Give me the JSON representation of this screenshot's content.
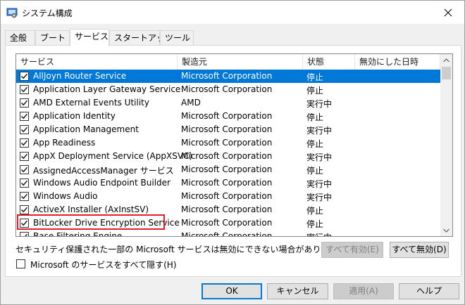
{
  "window": {
    "title": "システム構成"
  },
  "tabs": [
    {
      "label": "全般"
    },
    {
      "label": "ブート"
    },
    {
      "label": "サービス"
    },
    {
      "label": "スタートアップ"
    },
    {
      "label": "ツール"
    }
  ],
  "columns": {
    "service": "サービス",
    "manufacturer": "製造元",
    "status": "状態",
    "disabled_date": "無効にした日時"
  },
  "services": [
    {
      "name": "AllJoyn Router Service",
      "manufacturer": "Microsoft Corporation",
      "status": "停止",
      "checked": true,
      "selected": true
    },
    {
      "name": "Application Layer Gateway Service",
      "manufacturer": "Microsoft Corporation",
      "status": "停止",
      "checked": true
    },
    {
      "name": "AMD External Events Utility",
      "manufacturer": "AMD",
      "status": "実行中",
      "checked": true
    },
    {
      "name": "Application Identity",
      "manufacturer": "Microsoft Corporation",
      "status": "停止",
      "checked": true
    },
    {
      "name": "Application Management",
      "manufacturer": "Microsoft Corporation",
      "status": "実行中",
      "checked": true
    },
    {
      "name": "App Readiness",
      "manufacturer": "Microsoft Corporation",
      "status": "停止",
      "checked": true
    },
    {
      "name": "AppX Deployment Service (AppXSVC)",
      "manufacturer": "Microsoft Corporation",
      "status": "実行中",
      "checked": true
    },
    {
      "name": "AssignedAccessManager サービス",
      "manufacturer": "Microsoft Corporation",
      "status": "停止",
      "checked": true
    },
    {
      "name": "Windows Audio Endpoint Builder",
      "manufacturer": "Microsoft Corporation",
      "status": "実行中",
      "checked": true
    },
    {
      "name": "Windows Audio",
      "manufacturer": "Microsoft Corporation",
      "status": "実行中",
      "checked": true
    },
    {
      "name": "ActiveX Installer (AxInstSV)",
      "manufacturer": "Microsoft Corporation",
      "status": "停止",
      "checked": true
    },
    {
      "name": "BitLocker Drive Encryption Service",
      "manufacturer": "Microsoft Corporation",
      "status": "停止",
      "checked": true,
      "highlighted": true
    },
    {
      "name": "Base Filtering Engine",
      "manufacturer": "Microsoft Corporation",
      "status": "実行中",
      "checked": true
    }
  ],
  "note": "セキュリティ保護された一部の Microsoft サービスは無効にできない場合があります。",
  "buttons": {
    "enable_all": "すべて有効(E)",
    "disable_all": "すべて無効(D)",
    "ok": "OK",
    "cancel": "キャンセル",
    "apply": "適用(A)",
    "help": "ヘルプ"
  },
  "hide_ms": {
    "label": "Microsoft のサービスをすべて隠す(H)",
    "checked": false
  },
  "colors": {
    "selection": "#0078d7",
    "highlight_box": "#e0202a"
  }
}
